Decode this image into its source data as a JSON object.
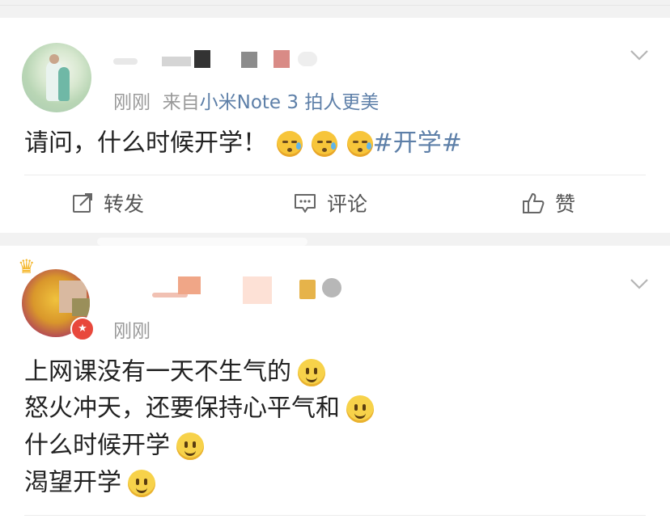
{
  "posts": [
    {
      "time": "刚刚",
      "source_prefix": "来自",
      "source": "小米Note 3 拍人更美",
      "text": "请问，什么时候开学！",
      "topic": "#开学#",
      "emojis": [
        "cry",
        "cry",
        "cry"
      ],
      "actions": {
        "repost": "转发",
        "comment": "评论",
        "like": "赞"
      }
    },
    {
      "time": "刚刚",
      "lines": [
        "上网课没有一天不生气的",
        "怒火冲天，还要保持心平气和",
        "什么时候开学",
        "渴望开学"
      ],
      "emoji": "smile"
    }
  ],
  "icons": {
    "menu": "chevron-down-icon",
    "repost": "edit-share-icon",
    "comment": "comment-icon",
    "like": "thumbs-up-icon",
    "vip": "crown-icon",
    "verified": "star-badge-icon"
  },
  "colors": {
    "link": "#5d7fa8",
    "meta": "#9a9a9a",
    "text": "#222222",
    "background": "#f2f2f2"
  }
}
